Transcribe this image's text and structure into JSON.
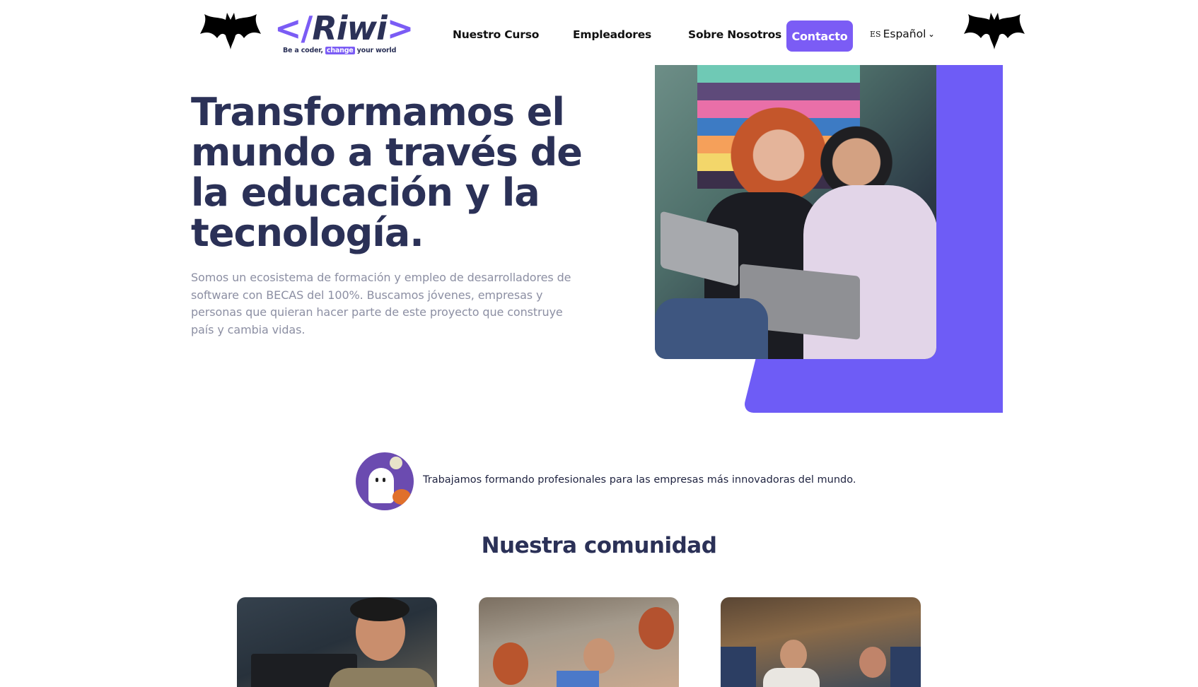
{
  "header": {
    "logo": {
      "open_bracket": "</",
      "name": "Riwi",
      "close_bracket": ">",
      "tagline_before": "Be a coder,",
      "tagline_highlight": "change",
      "tagline_after": "your world"
    },
    "nav": [
      {
        "label": "Nuestro Curso"
      },
      {
        "label": "Empleadores"
      },
      {
        "label": "Sobre Nosotros"
      }
    ],
    "contact_label": "Contacto",
    "language": {
      "code": "ES",
      "label": "Español"
    }
  },
  "hero": {
    "title": "Transformamos el mundo a través de la educación y la tecnología.",
    "subtitle": "Somos un ecosistema de formación y empleo de desarrolladores de software con BECAS del 100%. Buscamos jóvenes, empresas y personas que quieran hacer parte de este proyecto que construye país y cambia vidas."
  },
  "announcement": "Trabajamos formando profesionales para las empresas más innovadoras del mundo.",
  "community": {
    "title": "Nuestra comunidad"
  },
  "colors": {
    "accent": "#6e5cf6",
    "brand_dark": "#2b3157",
    "muted_text": "#8c8fa3"
  }
}
